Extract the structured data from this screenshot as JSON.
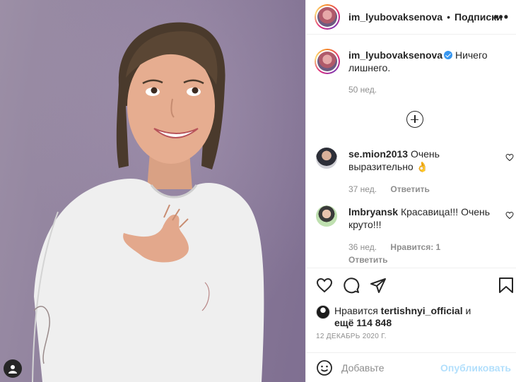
{
  "post": {
    "username": "im_lyubovaksenova",
    "dot": "•",
    "follow_label": "Подписки",
    "more": "•••"
  },
  "caption": {
    "username": "im_lyubovaksenova",
    "text": "Ничего лишнего.",
    "time": "50 нед."
  },
  "comments": [
    {
      "username": "se.mion2013",
      "text": "Очень выразительно 👌",
      "time": "37 нед.",
      "reply_label": "Ответить"
    },
    {
      "username": "lmbryansk",
      "text": "Красавица!!! Очень круто!!!",
      "time": "36 нед.",
      "likes_label": "Нравится: 1",
      "reply_label": "Ответить"
    }
  ],
  "likes": {
    "prefix": "Нравится",
    "user": "tertishnyi_official",
    "and": "и",
    "rest": "ещё 114 848"
  },
  "date": "12 ДЕКАБРЬ 2020 Г.",
  "add_comment": {
    "placeholder": "Добавьте",
    "publish_label": "Опубликовать"
  },
  "colors": {
    "accent": "#3897f0",
    "publish_disabled": "#b2dffc",
    "secondary_text": "#8e8e8e"
  }
}
